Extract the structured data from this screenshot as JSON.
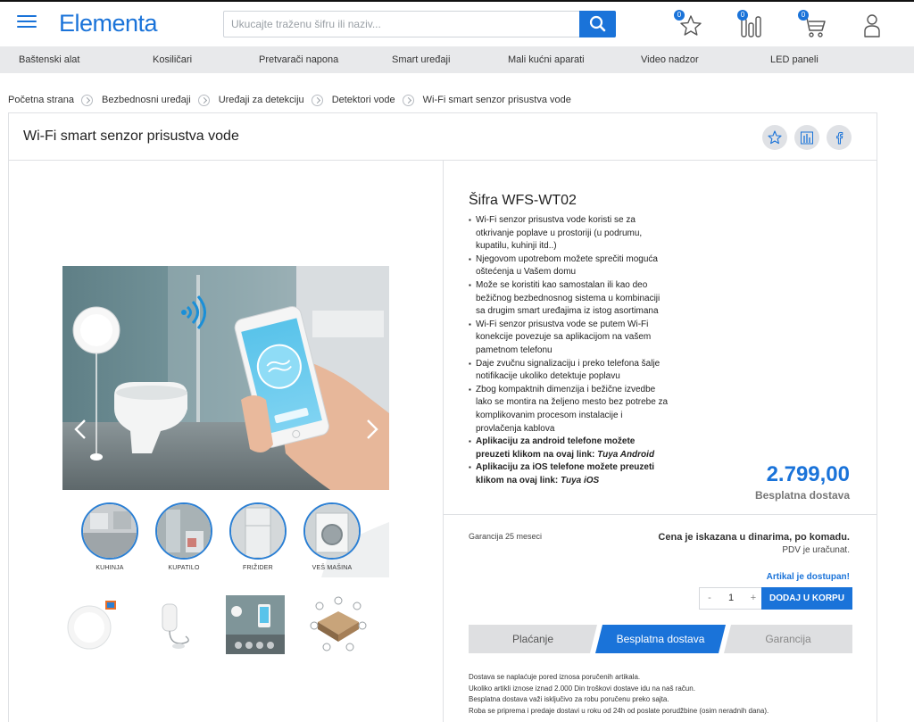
{
  "header": {
    "logo": "Elementa",
    "search_placeholder": "Ukucajte traženu šifru ili naziv...",
    "favorites_count": "0",
    "compare_count": "0",
    "cart_count": "0"
  },
  "categories": [
    "Baštenski alat",
    "Kosiličari",
    "Pretvarači napona",
    "Smart uređaji",
    "Mali kućni aparati",
    "Video nadzor",
    "LED paneli"
  ],
  "breadcrumb": [
    "Početna strana",
    "Bezbednosni uređaji",
    "Uređaji za detekciju",
    "Detektori vode",
    "Wi-Fi smart senzor prisustva vode"
  ],
  "product": {
    "title": "Wi-Fi smart senzor prisustva vode",
    "sku": "Šifra WFS-WT02",
    "features": [
      "Wi-Fi senzor prisustva vode koristi se za otkrivanje poplave u prostoriji (u podrumu, kupatilu, kuhinji itd..)",
      "Njegovom upotrebom možete sprečiti moguća oštećenja u Vašem domu",
      "Može se koristiti kao samostalan ili kao deo bežičnog bezbednosnog sistema u kombinaciji sa drugim smart uređajima iz istog asortimana",
      "Wi-Fi senzor prisustva vode se putem Wi-Fi konekcije povezuje sa aplikacijom na vašem pametnom telefonu",
      "Daje zvučnu signalizaciju i preko telefona šalje notifikacije ukoliko detektuje poplavu",
      "Zbog kompaktnih dimenzija i bežične izvedbe lako se montira na željeno mesto bez potrebe za komplikovanim procesom instalacije i provlačenja kablova"
    ],
    "app_android_text": "Aplikaciju za android telefone možete preuzeti klikom na ovaj link:",
    "app_android_link": "Tuya Android",
    "app_ios_text": "Aplikaciju za iOS telefone možete preuzeti klikom na ovaj link:",
    "app_ios_link": "Tuya iOS",
    "price": "2.799,00",
    "free_shipping": "Besplatna dostava",
    "warranty": "Garancija 25 meseci",
    "price_note": "Cena je iskazana u dinarima, po komadu.",
    "vat_note": "PDV je uračunat.",
    "availability": "Artikal je dostupan!",
    "quantity": "1",
    "qty_minus": "-",
    "qty_plus": "+",
    "add_to_cart": "DODAJ U KORPU"
  },
  "rooms": [
    "KUHINJA",
    "KUPATILO",
    "FRIŽIDER",
    "VEŠ MAŠINA"
  ],
  "tabs": {
    "payment": "Plaćanje",
    "shipping": "Besplatna dostava",
    "warranty": "Garancija",
    "active": "shipping"
  },
  "shipping_info": [
    "Dostava se naplaćuje pored iznosa poručenih artikala.",
    "Ukoliko artikli iznose iznad 2.000 Din troškovi dostave idu na naš račun.",
    "Besplatna dostava važi isključivo za robu poručenu preko sajta.",
    "Roba se priprema i predaje dostavi u roku od 24h od poslate porudžbine (osim neradnih dana)."
  ],
  "colors": {
    "brand": "#1a73d9",
    "catbar": "#e8e9eb",
    "tab_inactive": "#dedfe1"
  }
}
